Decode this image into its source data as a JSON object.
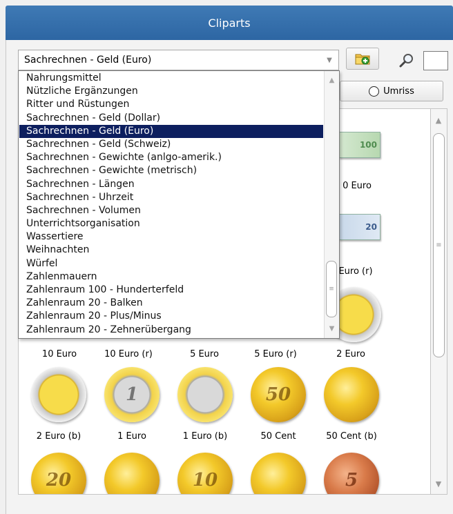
{
  "window": {
    "title": "Cliparts"
  },
  "category_select": {
    "value": "Sachrechnen - Geld (Euro)",
    "options": [
      "Nahrungsmittel",
      "Nützliche Ergänzungen",
      "Ritter und Rüstungen",
      "Sachrechnen - Geld (Dollar)",
      "Sachrechnen - Geld (Euro)",
      "Sachrechnen - Geld (Schweiz)",
      "Sachrechnen - Gewichte (anlgo-amerik.)",
      "Sachrechnen - Gewichte (metrisch)",
      "Sachrechnen - Längen",
      "Sachrechnen - Uhrzeit",
      "Sachrechnen - Volumen",
      "Unterrichtsorganisation",
      "Wassertiere",
      "Weihnachten",
      "Würfel",
      "Zahlenmauern",
      "Zahlenraum 100 - Hunderterfeld",
      "Zahlenraum 20 - Balken",
      "Zahlenraum 20 - Plus/Minus",
      "Zahlenraum 20 - Zehnerübergang"
    ],
    "selected_index": 4
  },
  "toolbar": {
    "add_icon": "folder-add-icon",
    "search_icon": "magnifier-icon",
    "search_value": ""
  },
  "umriss_button": {
    "label": "Umriss"
  },
  "gallery": {
    "partial_labels": [
      "0 Euro",
      "Euro (r)"
    ],
    "row1_labels": [
      "10 Euro",
      "10 Euro (r)",
      "5 Euro",
      "5 Euro (r)",
      "2 Euro"
    ],
    "row2_labels": [
      "2 Euro (b)",
      "1 Euro",
      "1 Euro (b)",
      "50 Cent",
      "50 Cent (b)"
    ],
    "row2_coins": [
      "",
      "1",
      "",
      "50",
      ""
    ],
    "row3_coins": [
      "20",
      "",
      "10",
      "",
      "5"
    ],
    "note_values": [
      "100",
      "20"
    ]
  },
  "colors": {
    "title_bar": "#3a74b0",
    "selection": "#0d1f5f"
  }
}
